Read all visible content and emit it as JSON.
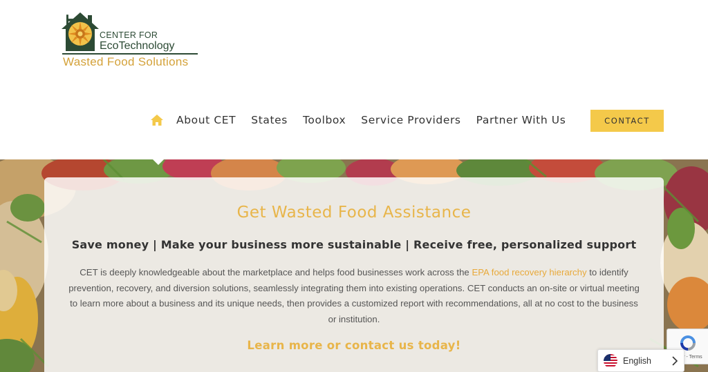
{
  "logo": {
    "mark": "CET",
    "line1": "CENTER FOR",
    "line2": "EcoTechnology",
    "tagline": "Wasted Food Solutions"
  },
  "nav": {
    "home_icon": "home-icon",
    "items": [
      "About CET",
      "States",
      "Toolbox",
      "Service Providers",
      "Partner With Us"
    ],
    "contact_label": "CONTACT"
  },
  "hero": {
    "title": "Get Wasted Food Assistance",
    "subtitle": "Save money | Make your business more sustainable | Receive free, personalized support",
    "body_before_link": "CET is deeply knowledgeable about the marketplace and helps food businesses work across the ",
    "body_link": "EPA food recovery hierarchy",
    "body_after_link": " to identify prevention, recovery, and diversion solutions, seamlessly integrating them into existing operations. CET conducts an on-site or virtual meeting to learn more about a business and its unique needs, then provides a customized report with recommendations, all at no cost to the business or institution.",
    "cta": "Learn more or contact us today!"
  },
  "recaptcha": {
    "text": "y - Terms"
  },
  "language": {
    "label": "English",
    "flag_icon": "us-flag-icon"
  },
  "colors": {
    "accent_gold": "#f4c94a",
    "title_gold": "#e8b54a",
    "logo_green": "#2c4a34",
    "text_dark": "#333333"
  }
}
